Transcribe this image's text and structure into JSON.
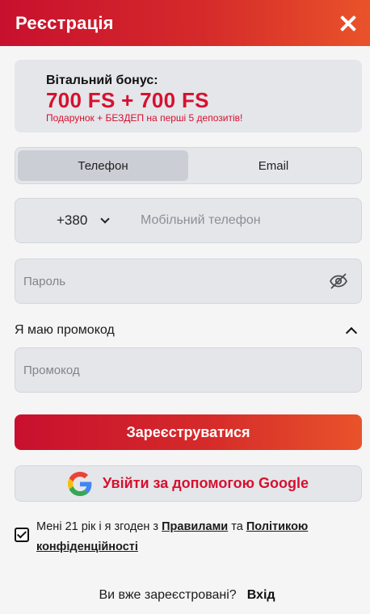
{
  "header": {
    "title": "Реєстрація",
    "close_icon": "close-icon"
  },
  "bonus": {
    "title": "Вітальний бонус:",
    "amount": "700 FS + 700 FS",
    "subtitle": "Подарунок + БЕЗДЕП на перші 5 депозитів!",
    "accent_color": "#d7102f"
  },
  "tabs": [
    {
      "label": "Телефон",
      "active": true
    },
    {
      "label": "Email",
      "active": false
    }
  ],
  "phone": {
    "country_code": "+380",
    "placeholder": "Мобільний телефон",
    "value": ""
  },
  "password": {
    "placeholder": "Пароль",
    "value": "",
    "visibility_icon": "eye-off-icon"
  },
  "promo": {
    "toggle_label": "Я маю промокод",
    "expanded": true,
    "placeholder": "Промокод",
    "value": ""
  },
  "register_button": {
    "label": "Зареєструватися"
  },
  "google_button": {
    "label": "Увійти за допомогою Google",
    "icon": "google-icon"
  },
  "agreement": {
    "checked": true,
    "text_before": "Мені 21 рік і я згоден з ",
    "rules_link": "Правилами",
    "text_middle": " та ",
    "privacy_link": "Політикою конфіденційності"
  },
  "footer": {
    "question": "Ви вже зареєстровані?",
    "login_link": "Вхід"
  },
  "colors": {
    "brand_red": "#c8102e",
    "brand_orange": "#e9532a",
    "field_bg": "#e4e6ea"
  }
}
